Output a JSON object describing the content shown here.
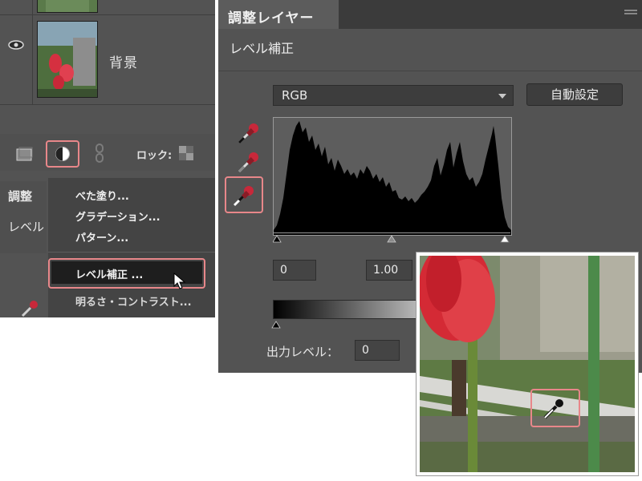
{
  "layers_panel": {
    "background_layer_name": "背景",
    "lock_label": "ロック:"
  },
  "left_sub_panel": {
    "tab_label": "調整",
    "subtitle": "レベル"
  },
  "context_menu": {
    "items": [
      "べた塗り...",
      "グラデーション...",
      "パターン...",
      "レベル補正 ...",
      "明るさ・コントラスト..."
    ],
    "selected_index": 3
  },
  "adjustments_panel": {
    "tab_label": "調整レイヤー",
    "title": "レベル補正",
    "channel_select": "RGB",
    "auto_button": "自動設定",
    "input_black": "0",
    "input_gamma": "1.00",
    "output_label": "出力レベル：",
    "output_black": "0"
  },
  "colors": {
    "panel_bg": "#535353",
    "highlight": "#e8878a",
    "tulip_red": "#d42a35"
  },
  "icons": [
    "eye-icon",
    "new-layer-icon",
    "adjustment-layer-icon",
    "link-icon",
    "lock-icon",
    "black-point-dropper-icon",
    "gray-point-dropper-icon",
    "white-point-dropper-icon",
    "chevron-down-icon"
  ]
}
